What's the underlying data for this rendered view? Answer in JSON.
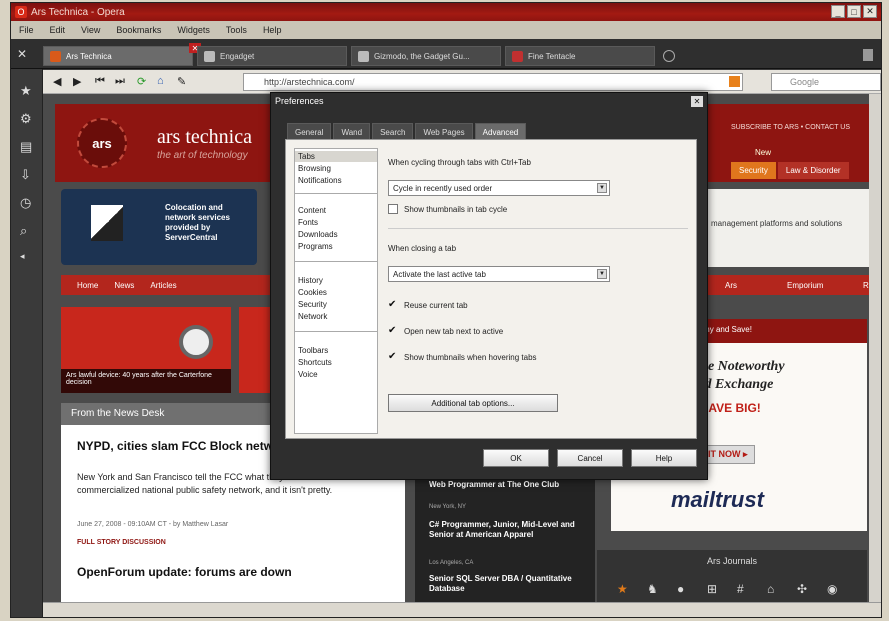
{
  "window": {
    "title": "Ars Technica - Opera"
  },
  "menu": [
    "File",
    "Edit",
    "View",
    "Bookmarks",
    "Widgets",
    "Tools",
    "Help"
  ],
  "tabs": [
    {
      "label": "Ars Technica",
      "active": true
    },
    {
      "label": "Engadget",
      "active": false
    },
    {
      "label": "Gizmodo, the Gadget Gu...",
      "active": false
    },
    {
      "label": "Fine Tentacle",
      "active": false
    }
  ],
  "address": {
    "value": "http://arstechnica.com/",
    "search_placeholder": "Google"
  },
  "site": {
    "logo": "ars",
    "title": "ars technica",
    "tagline": "the art of technology",
    "subscribe": "SUBSCRIBE TO ARS  •  CONTACT US",
    "new_tag": "New",
    "sections": [
      "Security",
      "Law & Disorder"
    ],
    "promo": "Colocation and network services provided by ServerCentral",
    "right_text": "management platforms and solutions",
    "nav": [
      "Home",
      "News",
      "Articles"
    ],
    "nav_right": [
      "Ars",
      "Emporium",
      "RSS"
    ],
    "story_caption": "Ars lawful device: 40 years after the Carterfone decision",
    "news_header": "From the News Desk",
    "headline1": "NYPD, cities slam FCC Block network dream",
    "body1": "New York and San Francisco tell the FCC what they think about a commercialized national public safety network, and it isn't pretty.",
    "meta1": "June 27, 2008 - 09:10AM CT - by Matthew Lasar",
    "meta2": "FULL STORY   DISCUSSION",
    "headline2": "OpenForum update: forums are down",
    "jobs": [
      {
        "title": "Web Programmer at The One Club",
        "loc": "New York, NY"
      },
      {
        "title": "C# Programmer, Junior, Mid-Level and Senior at American Apparel",
        "loc": "Los Angeles, CA"
      },
      {
        "title": "Senior SQL Server DBA / Quantitative Database",
        "loc": ""
      }
    ],
    "ad": {
      "band": "Exchange with Noteworthy and Save!",
      "line1": "Go fine Noteworthy",
      "line2": "Hosted Exchange",
      "line3": "AND SAVE BIG!",
      "price": "PRICE IT NOW ▸",
      "brand": "mailtrust"
    },
    "journals_title": "Ars Journals"
  },
  "dialog": {
    "title": "Preferences",
    "tabs": [
      "General",
      "Wand",
      "Search",
      "Web Pages",
      "Advanced"
    ],
    "active_tab": "Advanced",
    "list": [
      "Tabs",
      "Browsing",
      "Notifications",
      "Content",
      "Fonts",
      "Downloads",
      "Programs",
      "History",
      "Cookies",
      "Security",
      "Network",
      "Toolbars",
      "Shortcuts",
      "Voice"
    ],
    "ctrl_tab_label": "When cycling through tabs with Ctrl+Tab",
    "ctrl_tab_value": "Cycle in recently used order",
    "show_thumbs_label": "Show thumbnails in tab cycle",
    "closing_label": "When closing a tab",
    "closing_value": "Activate the last active tab",
    "reuse_label": "Reuse current tab",
    "open_next_label": "Open new tab next to active",
    "hover_label": "Show thumbnails when hovering tabs",
    "more_btn": "Additional tab options...",
    "ok": "OK",
    "cancel": "Cancel",
    "help": "Help"
  }
}
